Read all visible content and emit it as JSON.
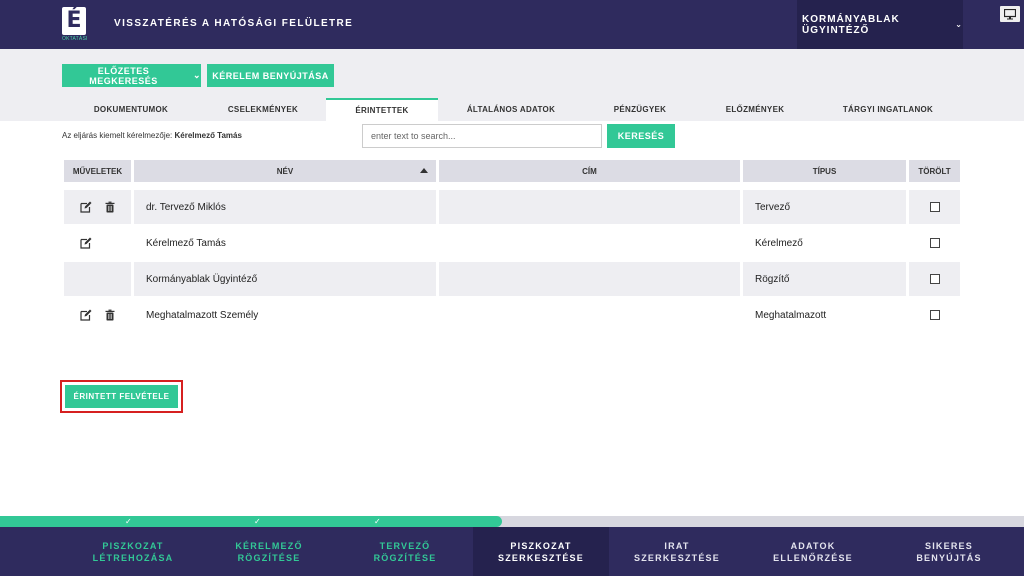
{
  "header": {
    "logo_letter": "É",
    "logo_sub": "OKTATÁSI",
    "title": "VISSZATÉRÉS A HATÓSÁGI FELÜLETRE",
    "user": "KORMÁNYABLAK ÜGYINTÉZŐ",
    "user_chevron": "⌄"
  },
  "toolbar": {
    "prelim_label": "ELŐZETES MEGKERESÉS",
    "submit_label": "KÉRELEM BENYÚJTÁSA"
  },
  "tabs": [
    {
      "label": "DOKUMENTUMOK"
    },
    {
      "label": "CSELEKMÉNYEK"
    },
    {
      "label": "ÉRINTETTEK"
    },
    {
      "label": "ÁLTALÁNOS ADATOK"
    },
    {
      "label": "PÉNZÜGYEK"
    },
    {
      "label": "ELŐZMÉNYEK"
    },
    {
      "label": "TÁRGYI INGATLANOK"
    }
  ],
  "active_tab": "ÉRINTETTEK",
  "applicant": {
    "label": "Az eljárás kiemelt kérelmezője:",
    "name": "Kérelmező Tamás"
  },
  "search": {
    "placeholder": "enter text to search...",
    "value": "",
    "button": "KERESÉS"
  },
  "table": {
    "columns": [
      "MŰVELETEK",
      "NÉV",
      "CÍM",
      "TÍPUS",
      "TÖRÖLT"
    ],
    "sorted_column": "NÉV",
    "sort_direction": "asc",
    "rows": [
      {
        "name": "dr. Tervező Miklós",
        "address": "",
        "type": "Tervező",
        "edit": true,
        "delete": true,
        "deleted": false
      },
      {
        "name": "Kérelmező Tamás",
        "address": "",
        "type": "Kérelmező",
        "edit": true,
        "delete": false,
        "deleted": false
      },
      {
        "name": "Kormányablak Ügyintéző",
        "address": "",
        "type": "Rögzítő",
        "edit": false,
        "delete": false,
        "deleted": false
      },
      {
        "name": "Meghatalmazott Személy",
        "address": "",
        "type": "Meghatalmazott",
        "edit": true,
        "delete": true,
        "deleted": false
      }
    ]
  },
  "add_button": "ÉRINTETT FELVÉTELE",
  "progress": {
    "fraction": 0.49,
    "check_glyph": "✓"
  },
  "steps": [
    {
      "label": "PISZKOZAT\nLÉTREHOZÁSA",
      "status": "done"
    },
    {
      "label": "KÉRELMEZŐ\nRÖGZÍTÉSE",
      "status": "done"
    },
    {
      "label": "TERVEZŐ\nRÖGZÍTÉSE",
      "status": "done"
    },
    {
      "label": "PISZKOZAT\nSZERKESZTÉSE",
      "status": "current"
    },
    {
      "label": "IRAT\nSZERKESZTÉSE",
      "status": "pending"
    },
    {
      "label": "ADATOK\nELLENŐRZÉSE",
      "status": "pending"
    },
    {
      "label": "SIKERES\nBENYÚJTÁS",
      "status": "pending"
    }
  ],
  "colors": {
    "header": "#2f2b5e",
    "accent": "#32c896",
    "highlight": "#d62020"
  }
}
